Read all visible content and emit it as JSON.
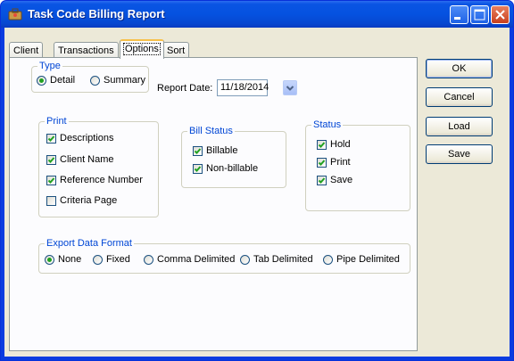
{
  "window": {
    "title": "Task Code Billing Report"
  },
  "tabs": [
    {
      "label": "Client"
    },
    {
      "label": "Transactions"
    },
    {
      "label": "Options"
    },
    {
      "label": "Sort"
    }
  ],
  "type_group": {
    "legend": "Type",
    "detail_label": "Detail",
    "summary_label": "Summary",
    "selected": "Detail"
  },
  "report_date": {
    "label": "Report Date:",
    "value": "11/18/2014"
  },
  "print_group": {
    "legend": "Print",
    "items": [
      {
        "label": "Descriptions",
        "checked": true
      },
      {
        "label": "Client Name",
        "checked": true
      },
      {
        "label": "Reference Number",
        "checked": true
      },
      {
        "label": "Criteria Page",
        "checked": false
      }
    ]
  },
  "bill_status_group": {
    "legend": "Bill Status",
    "items": [
      {
        "label": "Billable",
        "checked": true
      },
      {
        "label": "Non-billable",
        "checked": true
      }
    ]
  },
  "status_group": {
    "legend": "Status",
    "items": [
      {
        "label": "Hold",
        "checked": true
      },
      {
        "label": "Print",
        "checked": true
      },
      {
        "label": "Save",
        "checked": true
      }
    ]
  },
  "export_group": {
    "legend": "Export Data Format",
    "options": [
      "None",
      "Fixed",
      "Comma Delimited",
      "Tab Delimited",
      "Pipe Delimited"
    ],
    "selected": "None"
  },
  "buttons": {
    "ok": "OK",
    "cancel": "Cancel",
    "load": "Load",
    "save": "Save"
  }
}
